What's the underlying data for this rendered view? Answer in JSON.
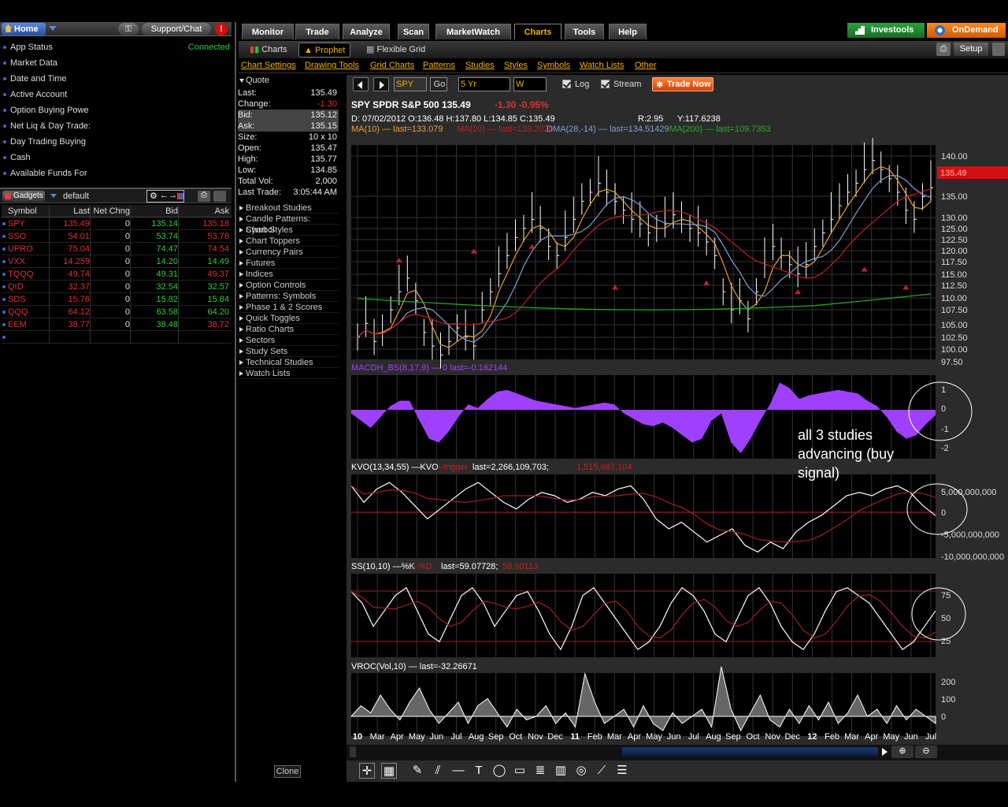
{
  "topbar": {
    "home": "Home",
    "support": "Support/Chat",
    "alert": "!"
  },
  "status": [
    {
      "label": "App Status",
      "value": "Connected"
    },
    {
      "label": "Market Data",
      "value": ""
    },
    {
      "label": "Date and Time",
      "value": ""
    },
    {
      "label": "Active Account",
      "value": ""
    },
    {
      "label": "Option Buying Powe",
      "value": ""
    },
    {
      "label": "Net Liq & Day Trade:",
      "value": ""
    },
    {
      "label": "Day Trading Buying",
      "value": ""
    },
    {
      "label": "Cash",
      "value": ""
    },
    {
      "label": "Available Funds For",
      "value": ""
    }
  ],
  "gadgets": {
    "label": "Gadgets",
    "list": "default"
  },
  "watchlist": {
    "headers": [
      "Symbol",
      "Last",
      "Net Chng",
      "Bid",
      "Ask"
    ],
    "rows": [
      [
        "SPY",
        "135.49",
        "0",
        "135.14",
        "135.18"
      ],
      [
        "SSO",
        "54.01",
        "0",
        "53.74",
        "53.78"
      ],
      [
        "UPRO",
        "75.04",
        "0",
        "74.47",
        "74.54"
      ],
      [
        "VXX",
        "14.259",
        "0",
        "14.20",
        "14.49"
      ],
      [
        "TQQQ",
        "49.74",
        "0",
        "49.31",
        "49.37"
      ],
      [
        "QID",
        "32.37",
        "0",
        "32.54",
        "32.57"
      ],
      [
        "SDS",
        "15.76",
        "0",
        "15.82",
        "15.84"
      ],
      [
        "QQQ",
        "64.12",
        "0",
        "63.58",
        "64.20"
      ],
      [
        "EEM",
        "38.77",
        "0",
        "38.48",
        "38.72"
      ]
    ]
  },
  "tabs": [
    "Monitor",
    "Trade",
    "Analyze",
    "Scan",
    "MarketWatch",
    "Charts",
    "Tools",
    "Help"
  ],
  "active_tab": "Charts",
  "brands": {
    "investools": "Investools",
    "ondemand": "OnDemand"
  },
  "subtabs": {
    "charts": "Charts",
    "prophet": "Prophet",
    "flexible": "Flexible Grid",
    "setup": "Setup"
  },
  "menus": [
    "Chart Settings",
    "Drawing Tools",
    "Grid Charts",
    "Patterns",
    "Studies",
    "Styles",
    "Symbols",
    "Watch Lists",
    "Other"
  ],
  "quote": {
    "title": "Quote",
    "rows": [
      [
        "Last:",
        "135.49"
      ],
      [
        "Change:",
        "-1.30"
      ],
      [
        "Bid:",
        "135.12"
      ],
      [
        "Ask:",
        "135.15"
      ],
      [
        "Size:",
        "10 x 10"
      ],
      [
        "Open:",
        "135.47"
      ],
      [
        "High:",
        "135.77"
      ],
      [
        "Low:",
        "134.85"
      ],
      [
        "Total Vol:",
        "2,000"
      ],
      [
        "Last Trade:",
        "3:05:44 AM"
      ]
    ]
  },
  "links": [
    "Breakout Studies",
    "Candle Patterns: Symbol",
    "Chart Styles",
    "Chart Toppers",
    "Currency Pairs",
    "Futures",
    "Indices",
    "Option Controls",
    "Patterns: Symbols",
    "Phase 1 & 2 Scores",
    "Quick Toggles",
    "Ratio Charts",
    "Sectors",
    "Study Sets",
    "Technical Studies",
    "Watch Lists"
  ],
  "clone": "Clone",
  "toolbar": {
    "symbol": "SPY",
    "go": "Go",
    "period": "5 Yr",
    "agg": "W",
    "log": "Log",
    "stream": "Stream",
    "trade": "Trade Now"
  },
  "chart_header": {
    "line1": "SPY SPDR S&P 500   135.49",
    "change": "-1.30   -0.95%",
    "ohlc": "D: 07/02/2012  O:136.48  H:137.80  L:134.85  C:135.49",
    "r": "R:2.95",
    "y": "Y:117.6238",
    "ma10": "MA(10) — last=133.079",
    "ma20": "MA(20) — last=133.2029",
    "dma": "DMA(28,-14) — last=134.51429",
    "ma200": "MA(200) — last=109.7353"
  },
  "studies": {
    "macd": "MACDH_BS(8,17,9) — 0 last=-0.162144",
    "kvo": "KVO(13,34,55) —KVO",
    "kvo_trig": " —trigger",
    "kvo_last": "last=2,266,109,703;",
    "kvo_last2": "1,515,687,104",
    "ss": "SS(10,10) —%K",
    "ss_d": " —%D",
    "ss_last": "last=59.07728;",
    "ss_last2": "58.90113",
    "vroc": "VROC(Vol,10) — last=-32.26671"
  },
  "annotation": [
    "all 3 studies",
    "advancing (buy",
    "signal)"
  ],
  "chart_data": {
    "type": "line",
    "price_axis": [
      "140.00",
      "135.00",
      "130.00",
      "125.00",
      "122.50",
      "120.00",
      "117.50",
      "115.00",
      "112.50",
      "110.00",
      "107.50",
      "105.00",
      "102.50",
      "100.00",
      "97.50"
    ],
    "price_marker": "135.49",
    "macd_axis": [
      "1",
      "0",
      "-1",
      "-2"
    ],
    "kvo_axis": [
      "5,000,000,000",
      "0",
      "-5,000,000,000",
      "-10,000,000,000"
    ],
    "ss_axis": [
      "75",
      "50",
      "25"
    ],
    "vroc_axis": [
      "200",
      "100",
      "0"
    ],
    "x_labels": [
      "10",
      "Mar",
      "Apr",
      "May",
      "Jun",
      "Jul",
      "Aug",
      "Sep",
      "Oct",
      "Nov",
      "Dec",
      "11",
      "Feb",
      "Mar",
      "Apr",
      "May",
      "Jun",
      "Jul",
      "Aug",
      "Sep",
      "Oct",
      "Nov",
      "Dec",
      "12",
      "Feb",
      "Mar",
      "Apr",
      "May",
      "Jun",
      "Jul"
    ],
    "x_bold": [
      "10",
      "11",
      "12"
    ],
    "colors": {
      "ma10": "#e8a030",
      "ma20": "#c02020",
      "dma": "#7fa0d0",
      "ma200": "#20b020",
      "macd": "#a040ff",
      "bar": "#ffffff"
    }
  }
}
